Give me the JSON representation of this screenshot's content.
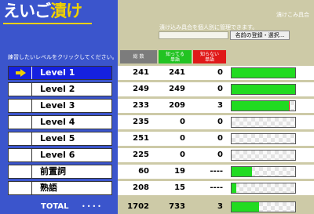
{
  "app": {
    "title_part1": "えいご",
    "title_part2": "漬け"
  },
  "header": {
    "manage_link": "漬けこみ具合",
    "manage_text": "漬け込み具合を個人別に管理できます。",
    "name_input_value": "",
    "register_button": "名前の登録・選択..."
  },
  "instruction": "練習したいレベルをクリックしてください。",
  "columns": {
    "total": "総 数",
    "known": "知ってる\n単語",
    "unknown": "知らない\n単語"
  },
  "levels": [
    {
      "label": "Level 1",
      "total": "241",
      "known": "241",
      "unknown": "0",
      "progress": 1.0,
      "selected": true
    },
    {
      "label": "Level 2",
      "total": "249",
      "known": "249",
      "unknown": "0",
      "progress": 1.0,
      "selected": false
    },
    {
      "label": "Level 3",
      "total": "233",
      "known": "209",
      "unknown": "3",
      "progress": 0.9,
      "unknown_progress": 0.013,
      "selected": false
    },
    {
      "label": "Level 4",
      "total": "235",
      "known": "0",
      "unknown": "0",
      "progress": 0.0,
      "selected": false
    },
    {
      "label": "Level 5",
      "total": "251",
      "known": "0",
      "unknown": "0",
      "progress": 0.0,
      "selected": false
    },
    {
      "label": "Level 6",
      "total": "225",
      "known": "0",
      "unknown": "0",
      "progress": 0.0,
      "selected": false
    },
    {
      "label": "前置詞",
      "total": "60",
      "known": "19",
      "unknown": "----",
      "progress": 0.32,
      "selected": false
    },
    {
      "label": "熟語",
      "total": "208",
      "known": "15",
      "unknown": "----",
      "progress": 0.07,
      "selected": false
    }
  ],
  "total": {
    "label": "TOTAL",
    "dots": "••••",
    "total": "1702",
    "known": "733",
    "unknown": "3",
    "progress": 0.43
  },
  "colors": {
    "accent_blue": "#3b55cc",
    "selected_blue": "#1521df",
    "known_green": "#21db21",
    "unknown_red": "#e01919",
    "title_yellow": "#f0d000"
  },
  "icons": {
    "selected_marker": "right-arrow-icon"
  }
}
